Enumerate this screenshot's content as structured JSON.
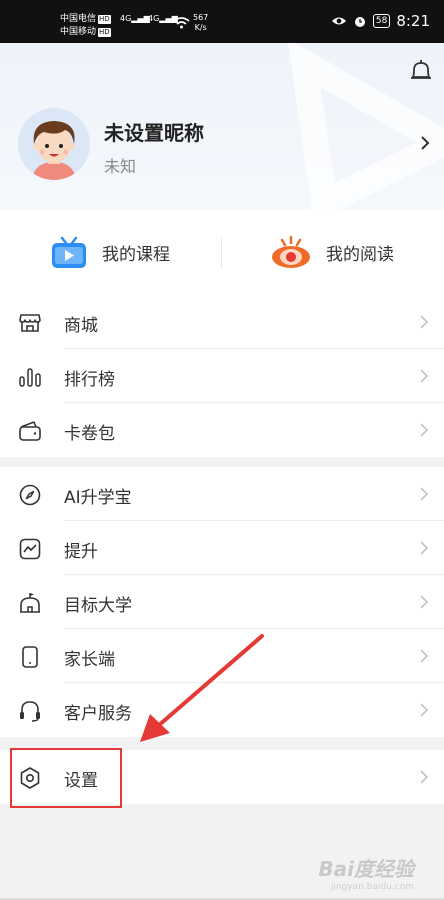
{
  "status_bar": {
    "carrier1": "中国电信",
    "carrier2": "中国移动",
    "hd": "HD",
    "signal_label": "4G",
    "speed_value": "567",
    "speed_unit": "K/s",
    "battery": "58",
    "time": "8:21"
  },
  "profile": {
    "nickname": "未设置昵称",
    "status": "未知"
  },
  "shortcuts": [
    {
      "label": "我的课程",
      "icon": "tv-icon"
    },
    {
      "label": "我的阅读",
      "icon": "eye-icon"
    }
  ],
  "menu_group1": [
    {
      "label": "商城",
      "icon": "shop-icon"
    },
    {
      "label": "排行榜",
      "icon": "ranking-icon"
    },
    {
      "label": "卡卷包",
      "icon": "wallet-icon"
    }
  ],
  "menu_group2": [
    {
      "label": "AI升学宝",
      "icon": "compass-icon"
    },
    {
      "label": "提升",
      "icon": "trend-icon"
    },
    {
      "label": "目标大学",
      "icon": "university-icon"
    },
    {
      "label": "家长端",
      "icon": "phone-icon"
    },
    {
      "label": "客户服务",
      "icon": "headset-icon"
    }
  ],
  "menu_group3": [
    {
      "label": "设置",
      "icon": "settings-icon"
    }
  ],
  "watermark": {
    "text": "Bai度经验",
    "sub": "jingyan.baidu.com"
  },
  "colors": {
    "accent_red": "#e53935",
    "tv_blue": "#2f8ef4",
    "eye_orange": "#f06b2a"
  }
}
